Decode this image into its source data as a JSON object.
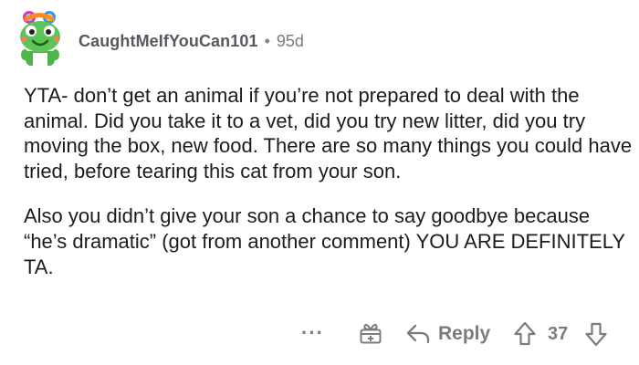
{
  "comment": {
    "author": "CaughtMeIfYouCan101",
    "separator": "•",
    "age": "95d",
    "paragraphs": [
      "YTA- don’t get an animal if you’re not prepared to deal with the animal. Did you take it to a vet, did you try new litter, did you try moving the box, new food. There are so many things you could have tried, before tearing this cat from your son.",
      "Also you didn’t give your son a chance to say goodbye because “he’s dramatic” (got from another comment) YOU ARE DEFINITELY TA."
    ]
  },
  "actions": {
    "more_label": "···",
    "reply_label": "Reply",
    "score": "37"
  },
  "icons": {
    "avatar": "snoo-avatar-green-frog",
    "award": "gift-award-icon",
    "reply": "reply-arrow-icon",
    "upvote": "upvote-arrow-icon",
    "downvote": "downvote-arrow-icon"
  },
  "colors": {
    "avatar_green": "#5ec45a",
    "meta_gray": "#7c7c7c",
    "text": "#1c1c1c"
  }
}
